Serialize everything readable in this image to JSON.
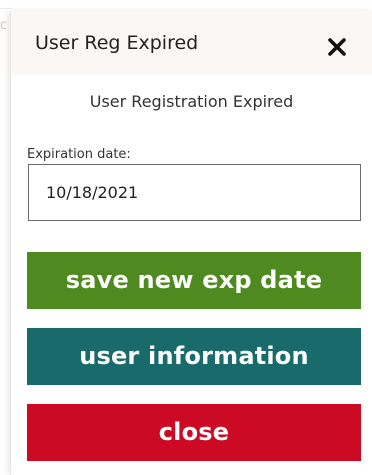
{
  "dialog": {
    "title": "User Reg Expired",
    "subtitle": "User Registration Expired",
    "close_icon": "close-x-icon"
  },
  "form": {
    "expiration_label": "Expiration date:",
    "expiration_value": "10/18/2021"
  },
  "actions": {
    "save_label": "save new exp date",
    "info_label": "user information",
    "close_label": "close"
  },
  "colors": {
    "save": "#4e8a1f",
    "info": "#196b6b",
    "close": "#cc0a23",
    "titlebar": "#fbf7f5"
  }
}
